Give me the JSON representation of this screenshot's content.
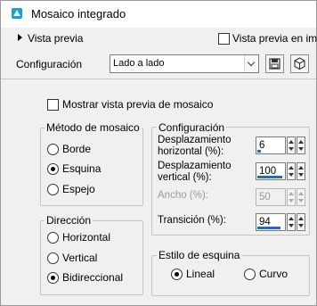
{
  "window": {
    "title": "Mosaico integrado"
  },
  "preview": {
    "label": "Vista previa",
    "mosaic_label": "Vista previa en ima"
  },
  "config": {
    "label": "Configuración",
    "selected": "Lado a lado"
  },
  "show_mosaic": {
    "label": "Mostrar vista previa de mosaico",
    "checked": false
  },
  "method": {
    "title": "Método de mosaico",
    "options": [
      {
        "label": "Borde",
        "selected": false
      },
      {
        "label": "Esquina",
        "selected": true
      },
      {
        "label": "Espejo",
        "selected": false
      }
    ]
  },
  "direction": {
    "title": "Dirección",
    "options": [
      {
        "label": "Horizontal",
        "selected": false
      },
      {
        "label": "Vertical",
        "selected": false
      },
      {
        "label": "Bidireccional",
        "selected": true
      }
    ]
  },
  "settings": {
    "title": "Configuración",
    "fields": [
      {
        "label": "Desplazamiento horizontal (%):",
        "value": "6",
        "enabled": true
      },
      {
        "label": "Desplazamiento vertical (%):",
        "value": "100",
        "enabled": true
      },
      {
        "label": "Ancho (%):",
        "value": "50",
        "enabled": false
      },
      {
        "label": "Transición (%):",
        "value": "94",
        "enabled": true
      }
    ]
  },
  "corner_style": {
    "title": "Estilo de esquina",
    "options": [
      {
        "label": "Lineal",
        "selected": true
      },
      {
        "label": "Curvo",
        "selected": false
      }
    ]
  },
  "colors": {
    "accent": "#1e6cc9",
    "title_icon": "#1aa0c8"
  }
}
